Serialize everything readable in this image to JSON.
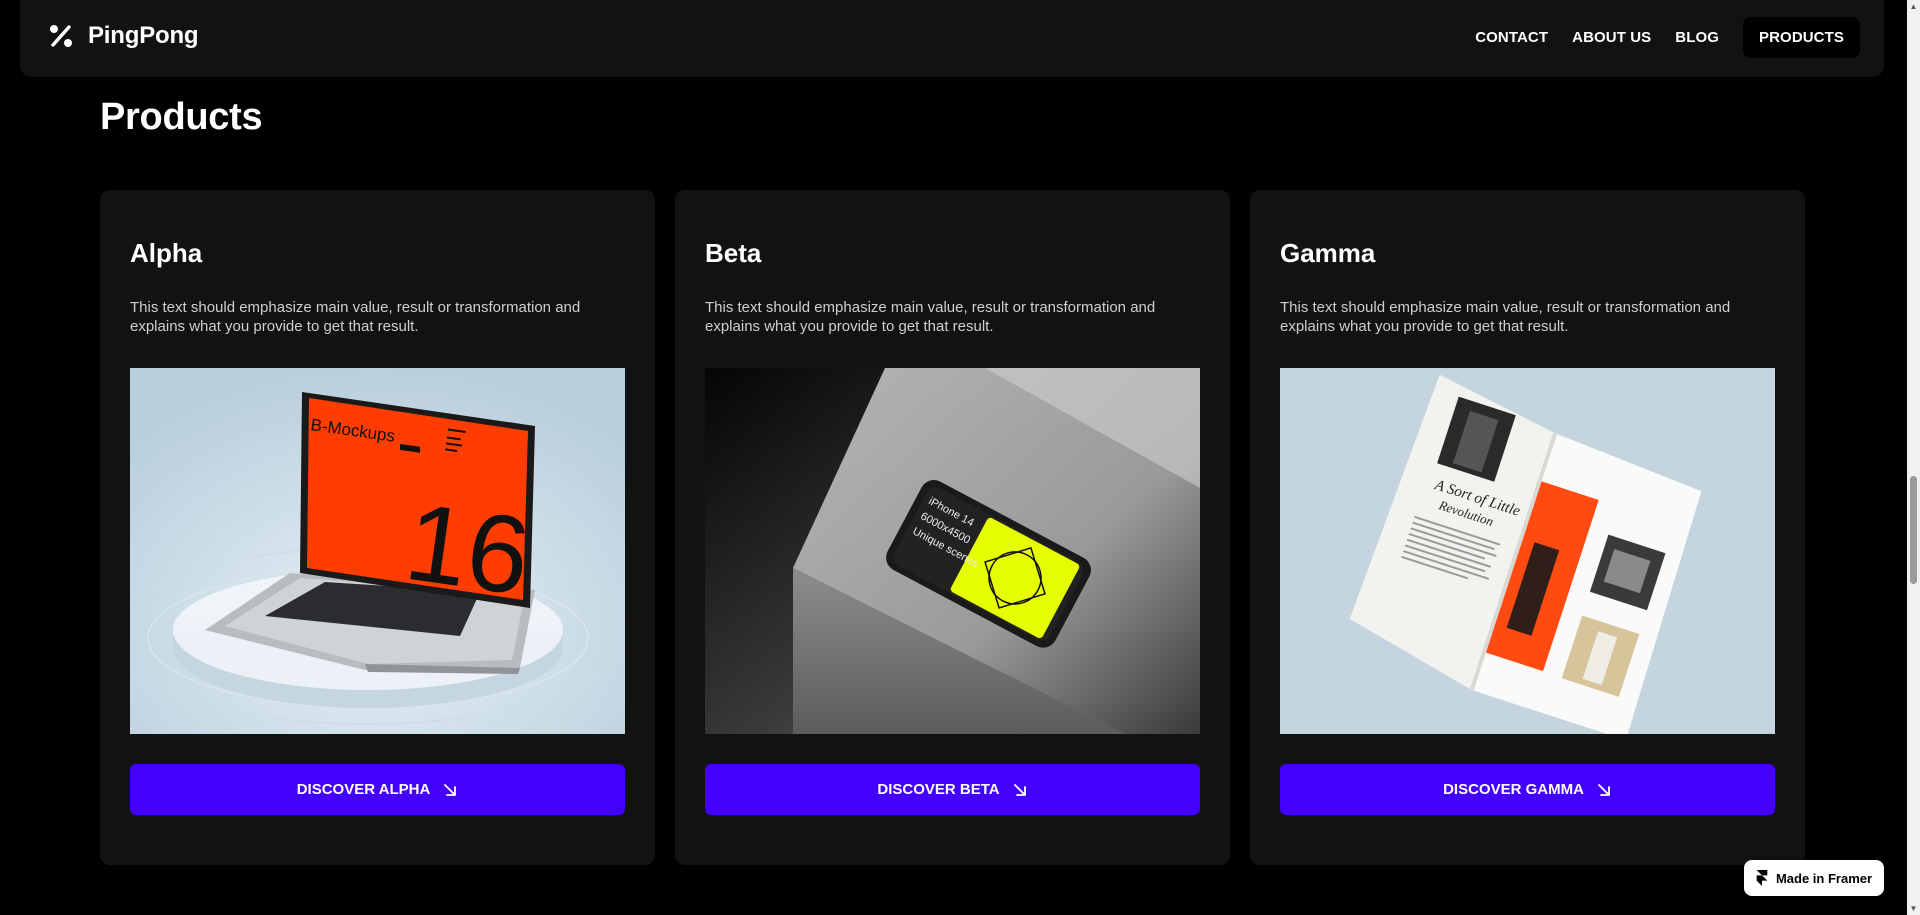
{
  "brand": {
    "name": "PingPong",
    "logo_icon": "percent-icon"
  },
  "nav": {
    "links": [
      {
        "label": "CONTACT"
      },
      {
        "label": "ABOUT US"
      },
      {
        "label": "BLOG"
      },
      {
        "label": "PRODUCTS",
        "active": true
      }
    ]
  },
  "page": {
    "title": "Products"
  },
  "products": [
    {
      "title": "Alpha",
      "description": "This text should emphasize main value, result or transformation and explains what you provide to get that result.",
      "button_label": "DISCOVER ALPHA",
      "image": {
        "name": "laptop-mockup-image",
        "screen_title": "B-Mockups",
        "screen_number": "16"
      }
    },
    {
      "title": "Beta",
      "description": "This text should emphasize main value, result or transformation and explains what you provide to get that result.",
      "button_label": "DISCOVER BETA",
      "image": {
        "name": "phone-mockup-image",
        "screen_lines": [
          "iPhone 14",
          "6000x4500",
          "Unique scenes"
        ]
      }
    },
    {
      "title": "Gamma",
      "description": "This text should emphasize main value, result or transformation and explains what you provide to get that result.",
      "button_label": "DISCOVER GAMMA",
      "image": {
        "name": "magazine-mockup-image",
        "headline": "A Sort of Little Revolution"
      }
    }
  ],
  "badge": {
    "label": "Made in Framer",
    "icon": "framer-icon"
  },
  "colors": {
    "background": "#000000",
    "card": "#121212",
    "accent": "#4400ff",
    "laptop_screen": "#ff3d00",
    "phone_screen": "#e6ff00"
  }
}
